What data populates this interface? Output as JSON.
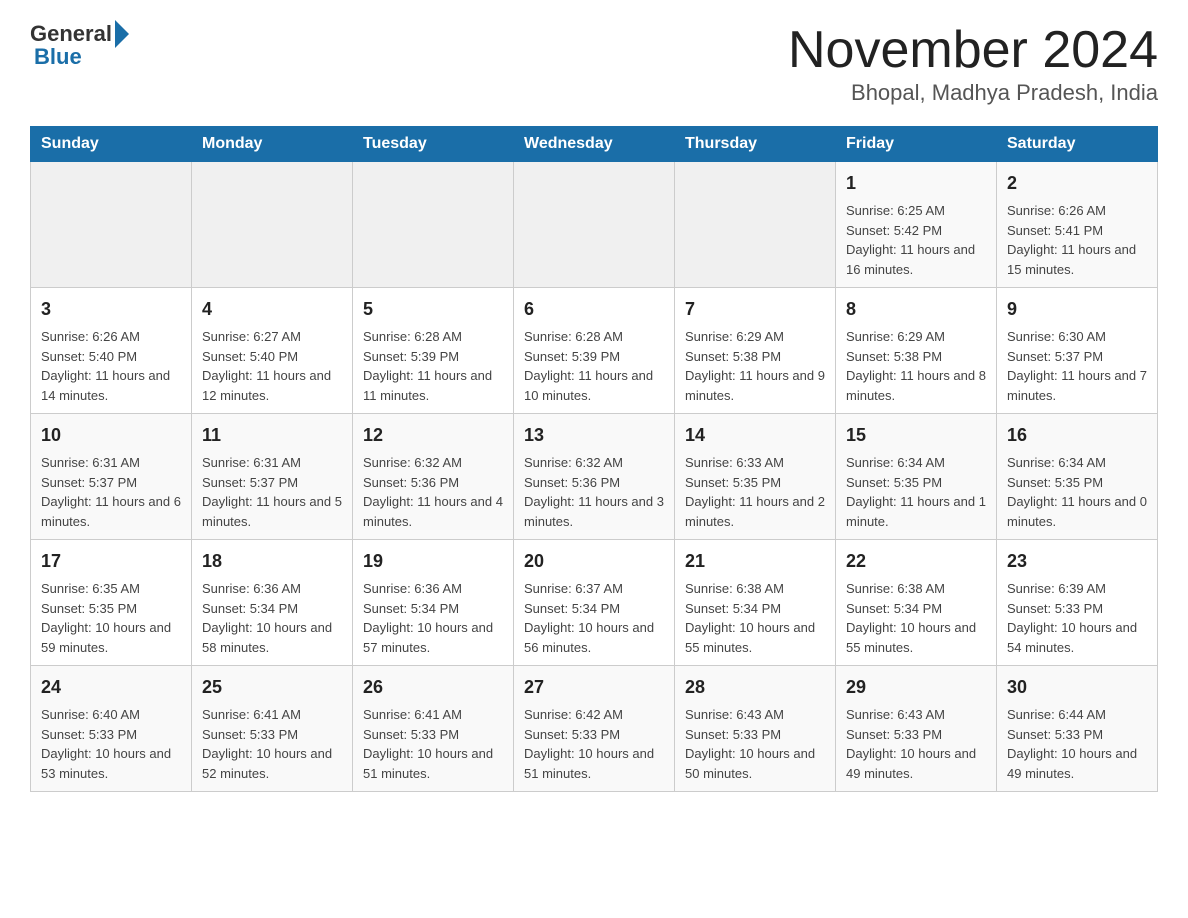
{
  "logo": {
    "text_general": "General",
    "text_blue": "Blue"
  },
  "title": "November 2024",
  "location": "Bhopal, Madhya Pradesh, India",
  "days_of_week": [
    "Sunday",
    "Monday",
    "Tuesday",
    "Wednesday",
    "Thursday",
    "Friday",
    "Saturday"
  ],
  "weeks": [
    [
      {
        "day": "",
        "sunrise": "",
        "sunset": "",
        "daylight": ""
      },
      {
        "day": "",
        "sunrise": "",
        "sunset": "",
        "daylight": ""
      },
      {
        "day": "",
        "sunrise": "",
        "sunset": "",
        "daylight": ""
      },
      {
        "day": "",
        "sunrise": "",
        "sunset": "",
        "daylight": ""
      },
      {
        "day": "",
        "sunrise": "",
        "sunset": "",
        "daylight": ""
      },
      {
        "day": "1",
        "sunrise": "Sunrise: 6:25 AM",
        "sunset": "Sunset: 5:42 PM",
        "daylight": "Daylight: 11 hours and 16 minutes."
      },
      {
        "day": "2",
        "sunrise": "Sunrise: 6:26 AM",
        "sunset": "Sunset: 5:41 PM",
        "daylight": "Daylight: 11 hours and 15 minutes."
      }
    ],
    [
      {
        "day": "3",
        "sunrise": "Sunrise: 6:26 AM",
        "sunset": "Sunset: 5:40 PM",
        "daylight": "Daylight: 11 hours and 14 minutes."
      },
      {
        "day": "4",
        "sunrise": "Sunrise: 6:27 AM",
        "sunset": "Sunset: 5:40 PM",
        "daylight": "Daylight: 11 hours and 12 minutes."
      },
      {
        "day": "5",
        "sunrise": "Sunrise: 6:28 AM",
        "sunset": "Sunset: 5:39 PM",
        "daylight": "Daylight: 11 hours and 11 minutes."
      },
      {
        "day": "6",
        "sunrise": "Sunrise: 6:28 AM",
        "sunset": "Sunset: 5:39 PM",
        "daylight": "Daylight: 11 hours and 10 minutes."
      },
      {
        "day": "7",
        "sunrise": "Sunrise: 6:29 AM",
        "sunset": "Sunset: 5:38 PM",
        "daylight": "Daylight: 11 hours and 9 minutes."
      },
      {
        "day": "8",
        "sunrise": "Sunrise: 6:29 AM",
        "sunset": "Sunset: 5:38 PM",
        "daylight": "Daylight: 11 hours and 8 minutes."
      },
      {
        "day": "9",
        "sunrise": "Sunrise: 6:30 AM",
        "sunset": "Sunset: 5:37 PM",
        "daylight": "Daylight: 11 hours and 7 minutes."
      }
    ],
    [
      {
        "day": "10",
        "sunrise": "Sunrise: 6:31 AM",
        "sunset": "Sunset: 5:37 PM",
        "daylight": "Daylight: 11 hours and 6 minutes."
      },
      {
        "day": "11",
        "sunrise": "Sunrise: 6:31 AM",
        "sunset": "Sunset: 5:37 PM",
        "daylight": "Daylight: 11 hours and 5 minutes."
      },
      {
        "day": "12",
        "sunrise": "Sunrise: 6:32 AM",
        "sunset": "Sunset: 5:36 PM",
        "daylight": "Daylight: 11 hours and 4 minutes."
      },
      {
        "day": "13",
        "sunrise": "Sunrise: 6:32 AM",
        "sunset": "Sunset: 5:36 PM",
        "daylight": "Daylight: 11 hours and 3 minutes."
      },
      {
        "day": "14",
        "sunrise": "Sunrise: 6:33 AM",
        "sunset": "Sunset: 5:35 PM",
        "daylight": "Daylight: 11 hours and 2 minutes."
      },
      {
        "day": "15",
        "sunrise": "Sunrise: 6:34 AM",
        "sunset": "Sunset: 5:35 PM",
        "daylight": "Daylight: 11 hours and 1 minute."
      },
      {
        "day": "16",
        "sunrise": "Sunrise: 6:34 AM",
        "sunset": "Sunset: 5:35 PM",
        "daylight": "Daylight: 11 hours and 0 minutes."
      }
    ],
    [
      {
        "day": "17",
        "sunrise": "Sunrise: 6:35 AM",
        "sunset": "Sunset: 5:35 PM",
        "daylight": "Daylight: 10 hours and 59 minutes."
      },
      {
        "day": "18",
        "sunrise": "Sunrise: 6:36 AM",
        "sunset": "Sunset: 5:34 PM",
        "daylight": "Daylight: 10 hours and 58 minutes."
      },
      {
        "day": "19",
        "sunrise": "Sunrise: 6:36 AM",
        "sunset": "Sunset: 5:34 PM",
        "daylight": "Daylight: 10 hours and 57 minutes."
      },
      {
        "day": "20",
        "sunrise": "Sunrise: 6:37 AM",
        "sunset": "Sunset: 5:34 PM",
        "daylight": "Daylight: 10 hours and 56 minutes."
      },
      {
        "day": "21",
        "sunrise": "Sunrise: 6:38 AM",
        "sunset": "Sunset: 5:34 PM",
        "daylight": "Daylight: 10 hours and 55 minutes."
      },
      {
        "day": "22",
        "sunrise": "Sunrise: 6:38 AM",
        "sunset": "Sunset: 5:34 PM",
        "daylight": "Daylight: 10 hours and 55 minutes."
      },
      {
        "day": "23",
        "sunrise": "Sunrise: 6:39 AM",
        "sunset": "Sunset: 5:33 PM",
        "daylight": "Daylight: 10 hours and 54 minutes."
      }
    ],
    [
      {
        "day": "24",
        "sunrise": "Sunrise: 6:40 AM",
        "sunset": "Sunset: 5:33 PM",
        "daylight": "Daylight: 10 hours and 53 minutes."
      },
      {
        "day": "25",
        "sunrise": "Sunrise: 6:41 AM",
        "sunset": "Sunset: 5:33 PM",
        "daylight": "Daylight: 10 hours and 52 minutes."
      },
      {
        "day": "26",
        "sunrise": "Sunrise: 6:41 AM",
        "sunset": "Sunset: 5:33 PM",
        "daylight": "Daylight: 10 hours and 51 minutes."
      },
      {
        "day": "27",
        "sunrise": "Sunrise: 6:42 AM",
        "sunset": "Sunset: 5:33 PM",
        "daylight": "Daylight: 10 hours and 51 minutes."
      },
      {
        "day": "28",
        "sunrise": "Sunrise: 6:43 AM",
        "sunset": "Sunset: 5:33 PM",
        "daylight": "Daylight: 10 hours and 50 minutes."
      },
      {
        "day": "29",
        "sunrise": "Sunrise: 6:43 AM",
        "sunset": "Sunset: 5:33 PM",
        "daylight": "Daylight: 10 hours and 49 minutes."
      },
      {
        "day": "30",
        "sunrise": "Sunrise: 6:44 AM",
        "sunset": "Sunset: 5:33 PM",
        "daylight": "Daylight: 10 hours and 49 minutes."
      }
    ]
  ]
}
